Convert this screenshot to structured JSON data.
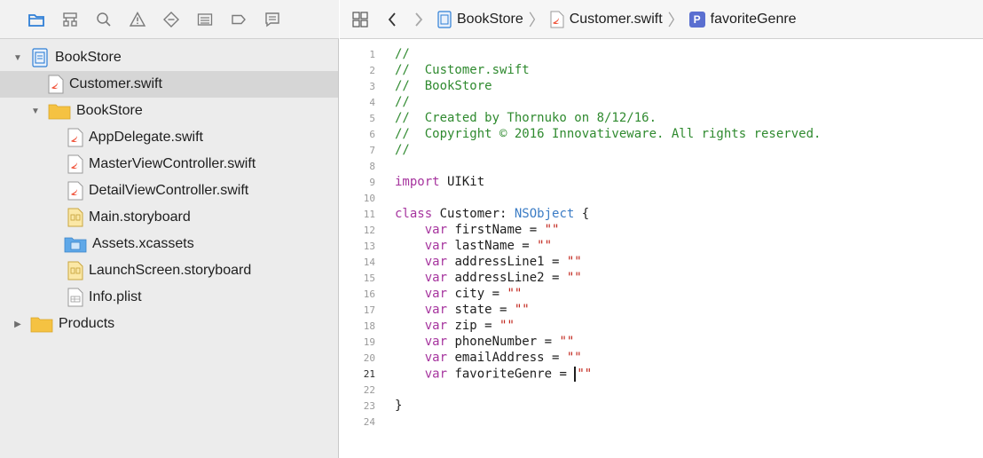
{
  "navigator": {
    "toolbar_icons": [
      {
        "name": "project-navigator-icon",
        "active": true
      },
      {
        "name": "symbol-navigator-icon",
        "active": false
      },
      {
        "name": "find-navigator-icon",
        "active": false
      },
      {
        "name": "issue-navigator-icon",
        "active": false
      },
      {
        "name": "test-navigator-icon",
        "active": false
      },
      {
        "name": "debug-navigator-icon",
        "active": false
      },
      {
        "name": "breakpoint-navigator-icon",
        "active": false
      },
      {
        "name": "report-navigator-icon",
        "active": false
      }
    ],
    "tree": {
      "project": "BookStore",
      "selected_file": "Customer.swift",
      "group": "BookStore",
      "files": [
        "AppDelegate.swift",
        "MasterViewController.swift",
        "DetailViewController.swift",
        "Main.storyboard",
        "Assets.xcassets",
        "LaunchScreen.storyboard",
        "Info.plist"
      ],
      "products": "Products"
    }
  },
  "jumpbar": {
    "project": "BookStore",
    "file": "Customer.swift",
    "symbol_badge": "P",
    "symbol": "favoriteGenre"
  },
  "editor": {
    "current_line": 21,
    "lines": [
      {
        "n": "1",
        "text": "//"
      },
      {
        "n": "2",
        "text": "//  Customer.swift"
      },
      {
        "n": "3",
        "text": "//  BookStore"
      },
      {
        "n": "4",
        "text": "//"
      },
      {
        "n": "5",
        "text": "//  Created by Thornuko on 8/12/16."
      },
      {
        "n": "6",
        "text": "//  Copyright © 2016 Innovativeware. All rights reserved."
      },
      {
        "n": "7",
        "text": "//"
      },
      {
        "n": "8",
        "text": ""
      },
      {
        "n": "9",
        "text": "import UIKit"
      },
      {
        "n": "10",
        "text": ""
      },
      {
        "n": "11",
        "text": "class Customer: NSObject {"
      },
      {
        "n": "12",
        "text": "    var firstName = \"\""
      },
      {
        "n": "13",
        "text": "    var lastName = \"\""
      },
      {
        "n": "14",
        "text": "    var addressLine1 = \"\""
      },
      {
        "n": "15",
        "text": "    var addressLine2 = \"\""
      },
      {
        "n": "16",
        "text": "    var city = \"\""
      },
      {
        "n": "17",
        "text": "    var state = \"\""
      },
      {
        "n": "18",
        "text": "    var zip = \"\""
      },
      {
        "n": "19",
        "text": "    var phoneNumber = \"\""
      },
      {
        "n": "20",
        "text": "    var emailAddress = \"\""
      },
      {
        "n": "21",
        "text": "    var favoriteGenre = \"\""
      },
      {
        "n": "22",
        "text": ""
      },
      {
        "n": "23",
        "text": "}"
      },
      {
        "n": "24",
        "text": ""
      }
    ]
  },
  "colors": {
    "comment": "#2f8a2f",
    "keyword": "#a6349e",
    "type": "#3b7cc5",
    "string": "#c2271d",
    "selection": "#d6d6d6",
    "folder": "#f5c242",
    "accent": "#2f7fd6"
  }
}
